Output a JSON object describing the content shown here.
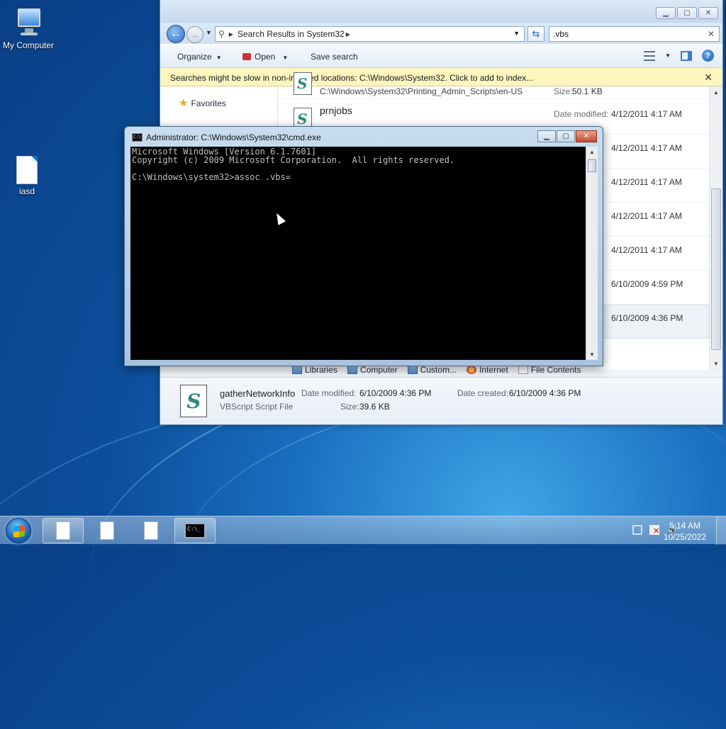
{
  "desktop": {
    "icons": [
      {
        "label": "My Computer",
        "icon": "computer-icon"
      },
      {
        "label": "iasd",
        "icon": "document-icon"
      }
    ]
  },
  "explorer": {
    "address": {
      "crumb": "Search Results in System32"
    },
    "search_value": ".vbs",
    "toolbar": {
      "organize": "Organize",
      "open": "Open",
      "save_search": "Save search"
    },
    "info_bar": "Searches might be slow in non-indexed locations: C:\\Windows\\System32. Click to add to index...",
    "nav_pane": {
      "favorites": "Favorites"
    },
    "results": [
      {
        "path": "C:\\Windows\\System32\\Printing_Admin_Scripts\\en-US",
        "size_label": "Size:",
        "size": "50.1 KB"
      },
      {
        "name": "prnjobs",
        "date_label": "Date modified:",
        "date": "4/12/2011 4:17 AM"
      },
      {
        "date": "4/12/2011 4:17 AM"
      },
      {
        "date": "4/12/2011 4:17 AM"
      },
      {
        "date": "4/12/2011 4:17 AM"
      },
      {
        "date": "4/12/2011 4:17 AM"
      },
      {
        "date": "6/10/2009 4:59 PM"
      },
      {
        "date": "6/10/2009 4:36 PM"
      }
    ],
    "search_again": [
      {
        "label": "Libraries",
        "icon": "libraries-icon"
      },
      {
        "label": "Computer",
        "icon": "computer-icon"
      },
      {
        "label": "Custom...",
        "icon": "folder-icon"
      },
      {
        "label": "Internet",
        "icon": "internet-explorer-icon"
      },
      {
        "label": "File Contents",
        "icon": "file-contents-icon"
      }
    ],
    "details": {
      "name": "gatherNetworkInfo",
      "type": "VBScript Script File",
      "date_modified_label": "Date modified:",
      "date_modified": "6/10/2009 4:36 PM",
      "date_created_label": "Date created:",
      "date_created": "6/10/2009 4:36 PM",
      "size_label": "Size:",
      "size": "39.6 KB"
    }
  },
  "cmd": {
    "title": "Administrator: C:\\Windows\\System32\\cmd.exe",
    "lines": [
      "Microsoft Windows [Version 6.1.7601]",
      "Copyright (c) 2009 Microsoft Corporation.  All rights reserved.",
      "",
      "C:\\Windows\\system32>assoc .vbs="
    ]
  },
  "taskbar": {
    "clock_time": "5:14 AM",
    "clock_date": "10/25/2022"
  }
}
